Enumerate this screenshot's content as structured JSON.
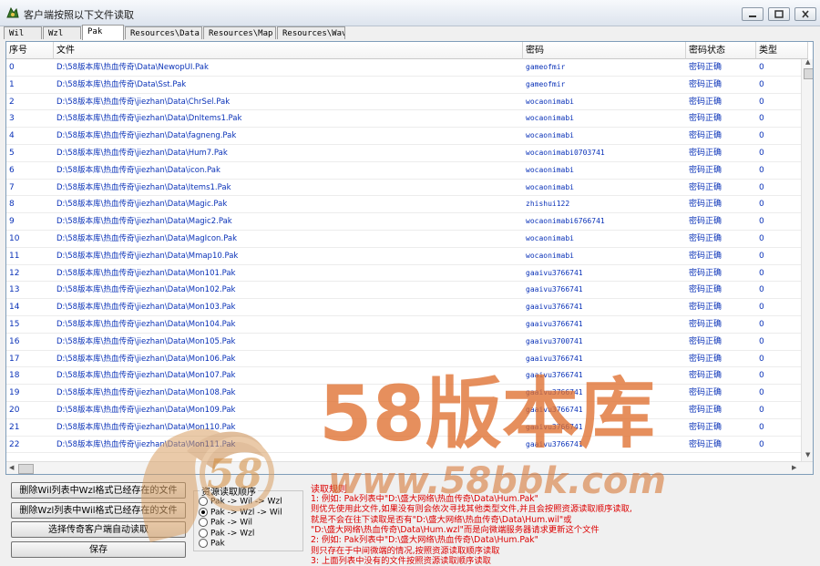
{
  "window": {
    "title": "客户端按照以下文件读取",
    "colors": {
      "titlebar_top": "#f7f9fc",
      "row_text": "#0a32b8",
      "rules_text": "#dd0000",
      "watermark": "#e07030"
    }
  },
  "tabs": [
    "Wil",
    "Wzl",
    "Pak",
    "Resources\\Data",
    "Resources\\Map",
    "Resources\\Wav"
  ],
  "active_tab": "Pak",
  "grid": {
    "columns": [
      "序号",
      "文件",
      "密码",
      "密码状态",
      "类型"
    ],
    "rows": [
      {
        "idx": "0",
        "file": "D:\\58版本库\\热血传奇\\Data\\NewopUI.Pak",
        "pwd": "gameofmir",
        "status": "密码正确",
        "type": "0"
      },
      {
        "idx": "1",
        "file": "D:\\58版本库\\热血传奇\\Data\\Sst.Pak",
        "pwd": "gameofmir",
        "status": "密码正确",
        "type": "0"
      },
      {
        "idx": "2",
        "file": "D:\\58版本库\\热血传奇\\jiezhan\\Data\\ChrSel.Pak",
        "pwd": "wocaonimabi",
        "status": "密码正确",
        "type": "0"
      },
      {
        "idx": "3",
        "file": "D:\\58版本库\\热血传奇\\jiezhan\\Data\\DnItems1.Pak",
        "pwd": "wocaonimabi",
        "status": "密码正确",
        "type": "0"
      },
      {
        "idx": "4",
        "file": "D:\\58版本库\\热血传奇\\jiezhan\\Data\\fagneng.Pak",
        "pwd": "wocaonimabi",
        "status": "密码正确",
        "type": "0"
      },
      {
        "idx": "5",
        "file": "D:\\58版本库\\热血传奇\\jiezhan\\Data\\Hum7.Pak",
        "pwd": "wocaonimabi0703741",
        "status": "密码正确",
        "type": "0"
      },
      {
        "idx": "6",
        "file": "D:\\58版本库\\热血传奇\\jiezhan\\Data\\icon.Pak",
        "pwd": "wocaonimabi",
        "status": "密码正确",
        "type": "0"
      },
      {
        "idx": "7",
        "file": "D:\\58版本库\\热血传奇\\jiezhan\\Data\\Items1.Pak",
        "pwd": "wocaonimabi",
        "status": "密码正确",
        "type": "0"
      },
      {
        "idx": "8",
        "file": "D:\\58版本库\\热血传奇\\jiezhan\\Data\\Magic.Pak",
        "pwd": "zhishui122",
        "status": "密码正确",
        "type": "0"
      },
      {
        "idx": "9",
        "file": "D:\\58版本库\\热血传奇\\jiezhan\\Data\\Magic2.Pak",
        "pwd": "wocaonimabi6766741",
        "status": "密码正确",
        "type": "0"
      },
      {
        "idx": "10",
        "file": "D:\\58版本库\\热血传奇\\jiezhan\\Data\\MagIcon.Pak",
        "pwd": "wocaonimabi",
        "status": "密码正确",
        "type": "0"
      },
      {
        "idx": "11",
        "file": "D:\\58版本库\\热血传奇\\jiezhan\\Data\\Mmap10.Pak",
        "pwd": "wocaonimabi",
        "status": "密码正确",
        "type": "0"
      },
      {
        "idx": "12",
        "file": "D:\\58版本库\\热血传奇\\jiezhan\\Data\\Mon101.Pak",
        "pwd": "gaaivu3766741",
        "status": "密码正确",
        "type": "0"
      },
      {
        "idx": "13",
        "file": "D:\\58版本库\\热血传奇\\jiezhan\\Data\\Mon102.Pak",
        "pwd": "gaaivu3766741",
        "status": "密码正确",
        "type": "0"
      },
      {
        "idx": "14",
        "file": "D:\\58版本库\\热血传奇\\jiezhan\\Data\\Mon103.Pak",
        "pwd": "gaaivu3766741",
        "status": "密码正确",
        "type": "0"
      },
      {
        "idx": "15",
        "file": "D:\\58版本库\\热血传奇\\jiezhan\\Data\\Mon104.Pak",
        "pwd": "gaaivu3766741",
        "status": "密码正确",
        "type": "0"
      },
      {
        "idx": "16",
        "file": "D:\\58版本库\\热血传奇\\jiezhan\\Data\\Mon105.Pak",
        "pwd": "gaaivu3700741",
        "status": "密码正确",
        "type": "0"
      },
      {
        "idx": "17",
        "file": "D:\\58版本库\\热血传奇\\jiezhan\\Data\\Mon106.Pak",
        "pwd": "gaaivu3766741",
        "status": "密码正确",
        "type": "0"
      },
      {
        "idx": "18",
        "file": "D:\\58版本库\\热血传奇\\jiezhan\\Data\\Mon107.Pak",
        "pwd": "gaaivu3766741",
        "status": "密码正确",
        "type": "0"
      },
      {
        "idx": "19",
        "file": "D:\\58版本库\\热血传奇\\jiezhan\\Data\\Mon108.Pak",
        "pwd": "gaaivu3766741",
        "status": "密码正确",
        "type": "0"
      },
      {
        "idx": "20",
        "file": "D:\\58版本库\\热血传奇\\jiezhan\\Data\\Mon109.Pak",
        "pwd": "gaaivu3766741",
        "status": "密码正确",
        "type": "0"
      },
      {
        "idx": "21",
        "file": "D:\\58版本库\\热血传奇\\jiezhan\\Data\\Mon110.Pak",
        "pwd": "gaaivu3766741",
        "status": "密码正确",
        "type": "0"
      },
      {
        "idx": "22",
        "file": "D:\\58版本库\\热血传奇\\jiezhan\\Data\\Mon111.Pak",
        "pwd": "gaaivu3766741",
        "status": "密码正确",
        "type": "0"
      }
    ]
  },
  "buttons": {
    "delete_wil": "删除Wil列表中Wzl格式已经存在的文件",
    "delete_wzl": "删除Wzl列表中Wil格式已经存在的文件",
    "auto_read": "选择传奇客户端自动读取",
    "save": "保存"
  },
  "read_order": {
    "title": "资源读取顺序",
    "options": [
      {
        "label": "Pak -> Wil -> Wzl",
        "checked": false
      },
      {
        "label": "Pak -> Wzl -> Wil",
        "checked": true
      },
      {
        "label": "Pak -> Wil",
        "checked": false
      },
      {
        "label": "Pak -> Wzl",
        "checked": false
      },
      {
        "label": "Pak",
        "checked": false
      }
    ]
  },
  "rules": {
    "title": "读取规则",
    "lines": [
      "1: 例如: Pak列表中\"D:\\盛大网络\\热血传奇\\Data\\Hum.Pak\"",
      "   则优先使用此文件,如果没有则会依次寻找其他类型文件,并且会按照资源读取顺序读取,",
      "   就是不会在往下读取是否有\"D:\\盛大网络\\热血传奇\\Data\\Hum.wil\"或",
      "   \"D:\\盛大网络\\热血传奇\\Data\\Hum.wzl\"而是向微端服务器请求更新这个文件",
      "2: 例如: Pak列表中\"D:\\盛大网络\\热血传奇\\Data\\Hum.Pak\"",
      "   则只存在于中间微端的情况,按照资源读取顺序读取",
      "3: 上面列表中没有的文件按照资源读取顺序读取"
    ]
  },
  "watermark": {
    "logo_text": "58版本库",
    "badge_text": "58",
    "url_text": "www.58bbk.com"
  }
}
